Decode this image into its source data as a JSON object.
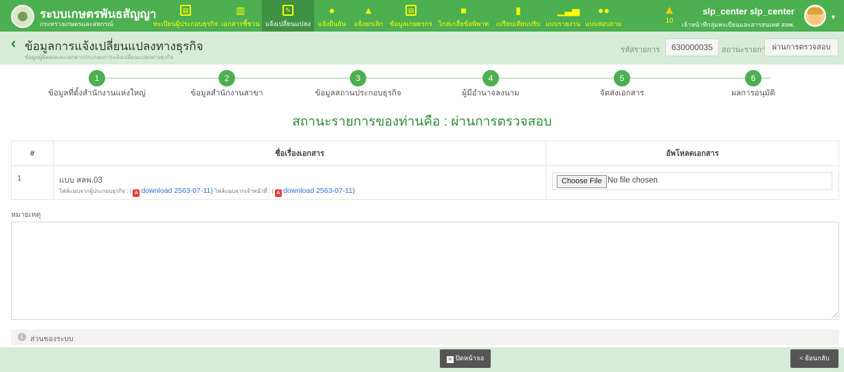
{
  "brand": {
    "title": "ระบบเกษตรพันธสัญญา",
    "subtitle": "กระทรวงเกษตรและสหกรณ์"
  },
  "nav": [
    {
      "label": "ทะเบียนผู้ประกอบธุรกิจ",
      "icon": "id-card-icon"
    },
    {
      "label": "เอกสารชี้ชวน",
      "icon": "clipboard-icon"
    },
    {
      "label": "แจ้งเปลี่ยนแปลง",
      "icon": "edit-icon",
      "active": true
    },
    {
      "label": "แจ้งยืนยัน",
      "icon": "check-circle-icon"
    },
    {
      "label": "แจ้งยกเลิก",
      "icon": "warning-icon"
    },
    {
      "label": "ข้อมูลเกษตรกร",
      "icon": "farmer-card-icon"
    },
    {
      "label": "ไกล่เกลี่ยข้อพิพาท",
      "icon": "chat-icon"
    },
    {
      "label": "เปรียบเทียบปรับ",
      "icon": "document-icon"
    },
    {
      "label": "แบบรายงาน",
      "icon": "bar-chart-icon"
    },
    {
      "label": "แบบสอบถาม",
      "icon": "comments-icon"
    }
  ],
  "notifications": {
    "count": "10"
  },
  "user": {
    "name": "slp_center slp_center",
    "role": "เจ้าหน้าที่กลุ่มทะเบียนและสารสนเทศ สลพ."
  },
  "page": {
    "title": "ข้อมูลการแจ้งเปลี่ยนแปลงทางธุรกิจ",
    "subtitle": "ข้อมูลผู้ติดต่อและเอกสารประกอบการแจ้งเปลี่ยนแปลงทางธุรกิจ",
    "code_label": "รหัสรายการ",
    "code_value": "630000035",
    "status_label": "สถานะรายการ",
    "status_value": "ผ่านการตรวจสอบ"
  },
  "steps": [
    {
      "num": "1",
      "label": "ข้อมูลที่ตั้งสำนักงานแห่งใหญ่"
    },
    {
      "num": "2",
      "label": "ข้อมูลสำนักงานสาขา"
    },
    {
      "num": "3",
      "label": "ข้อมูลสถานประกอบธุรกิจ"
    },
    {
      "num": "4",
      "label": "ผู้มีอำนาจลงนาม"
    },
    {
      "num": "5",
      "label": "จัดส่งเอกสาร"
    },
    {
      "num": "6",
      "label": "ผลการอนุมัติ"
    }
  ],
  "status_heading": "สถานะรายการของท่านคือ : ผ่านการตรวจสอบ",
  "table": {
    "headers": [
      "#",
      "ชื่อเรื่องเอกสาร",
      "อัพโหลดเอกสาร"
    ],
    "rows": [
      {
        "index": "1",
        "doc_name": "แบบ สลพ.03",
        "file_from_owner_label": "ไฟล์แนบจากผู้ประกอบธุรกิจ :",
        "file_from_owner_link": "download 2563-07-11)",
        "file_from_staff_label": "ไฟล์แนบจากเจ้าหน้าที่ :",
        "file_from_staff_link": "download 2563-07-11)",
        "choose_file_label": "Choose File",
        "no_file_text": "No file chosen"
      }
    ]
  },
  "remark": {
    "label": "หมายเหตุ",
    "value": ""
  },
  "system_section": {
    "label": "ส่วนของระบบ"
  },
  "footer": {
    "close_label": "ปิดหน้าจอ",
    "back_label": "< ย้อนกลับ"
  }
}
